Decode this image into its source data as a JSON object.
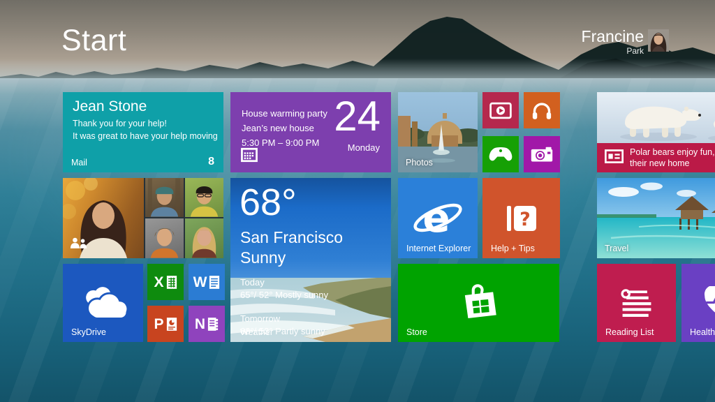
{
  "header": {
    "title": "Start",
    "user_first": "Francine",
    "user_last": "Park"
  },
  "colors": {
    "mail": "#0fa0a8",
    "calendar": "#7d3fae",
    "video": "#b5284d",
    "music": "#d2601f",
    "games": "#16a005",
    "camera": "#a118a8",
    "news_banner": "#bb1a47",
    "ie": "#2b80d9",
    "help": "#d0542c",
    "skydrive": "#1c58bf",
    "excel": "#0e8b0e",
    "word": "#2b7cd3",
    "powerpoint": "#c8441f",
    "onenote": "#8f43bd",
    "store": "#00a300",
    "reading_list": "#bf1d4f",
    "health": "#6a40c3",
    "weather_sky_top": "#1b6bc8"
  },
  "tiles": {
    "mail": {
      "sender": "Jean Stone",
      "subject": "Thank you for your help!",
      "preview": "It was great to have your help moving",
      "label": "Mail",
      "badge": "8"
    },
    "calendar": {
      "title": "House warming party",
      "location": "Jean’s new house",
      "time": "5:30 PM – 9:00 PM",
      "date": "24",
      "weekday": "Monday"
    },
    "photos": {
      "label": "Photos"
    },
    "news": {
      "headline_line1": "Polar bears enjoy fun, free",
      "headline_line2": "their new home"
    },
    "weather": {
      "temperature": "68°",
      "city": "San Francisco",
      "condition": "Sunny",
      "today_label": "Today",
      "today_forecast": "65°/ 52° Mostly sunny",
      "tomorrow_label": "Tomorrow",
      "tomorrow_forecast": "68°/ 53° Partly sunny",
      "label": "Weather"
    },
    "internet_explorer": {
      "label": "Internet Explorer"
    },
    "help_tips": {
      "label": "Help + Tips"
    },
    "skydrive": {
      "label": "SkyDrive"
    },
    "office": {
      "excel": "X",
      "word": "W",
      "powerpoint": "P",
      "onenote": "N"
    },
    "store": {
      "label": "Store"
    },
    "travel": {
      "label": "Travel"
    },
    "reading_list": {
      "label": "Reading List"
    },
    "health": {
      "label": "Health & Fitness"
    }
  },
  "icons": {
    "video": "play-screen-icon",
    "music": "headphones-icon",
    "games": "game-controller-icon",
    "camera": "camera-icon",
    "news": "newspaper-icon",
    "people": "people-icon",
    "calendar": "calendar-grid-icon",
    "internet_explorer": "ie-logo-icon",
    "help_tips": "book-question-icon",
    "skydrive": "clouds-icon",
    "store": "shopping-bag-windows-icon",
    "reading_list": "reading-list-icon",
    "health": "heart-pulse-icon"
  }
}
